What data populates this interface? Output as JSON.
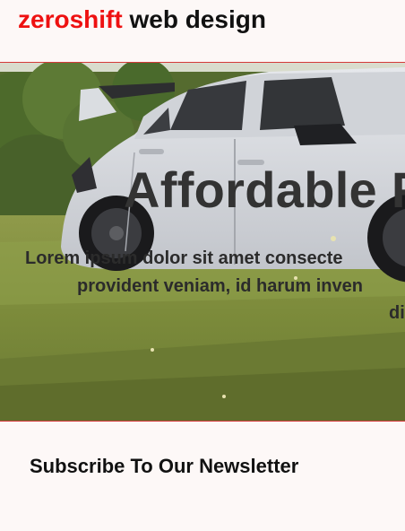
{
  "header": {
    "brand_accent": "zeroshift",
    "brand_rest": " web design"
  },
  "hero": {
    "title": "Affordable P",
    "text_line_1": "Lorem ipsum dolor sit amet consecte",
    "text_line_2": "provident veniam, id harum inven",
    "text_line_3": "di"
  },
  "newsletter": {
    "title": "Subscribe To Our Newsletter"
  },
  "colors": {
    "brand_accent": "#ee1111",
    "hero_border": "#d43a3a",
    "page_background": "#fdf8f7"
  }
}
